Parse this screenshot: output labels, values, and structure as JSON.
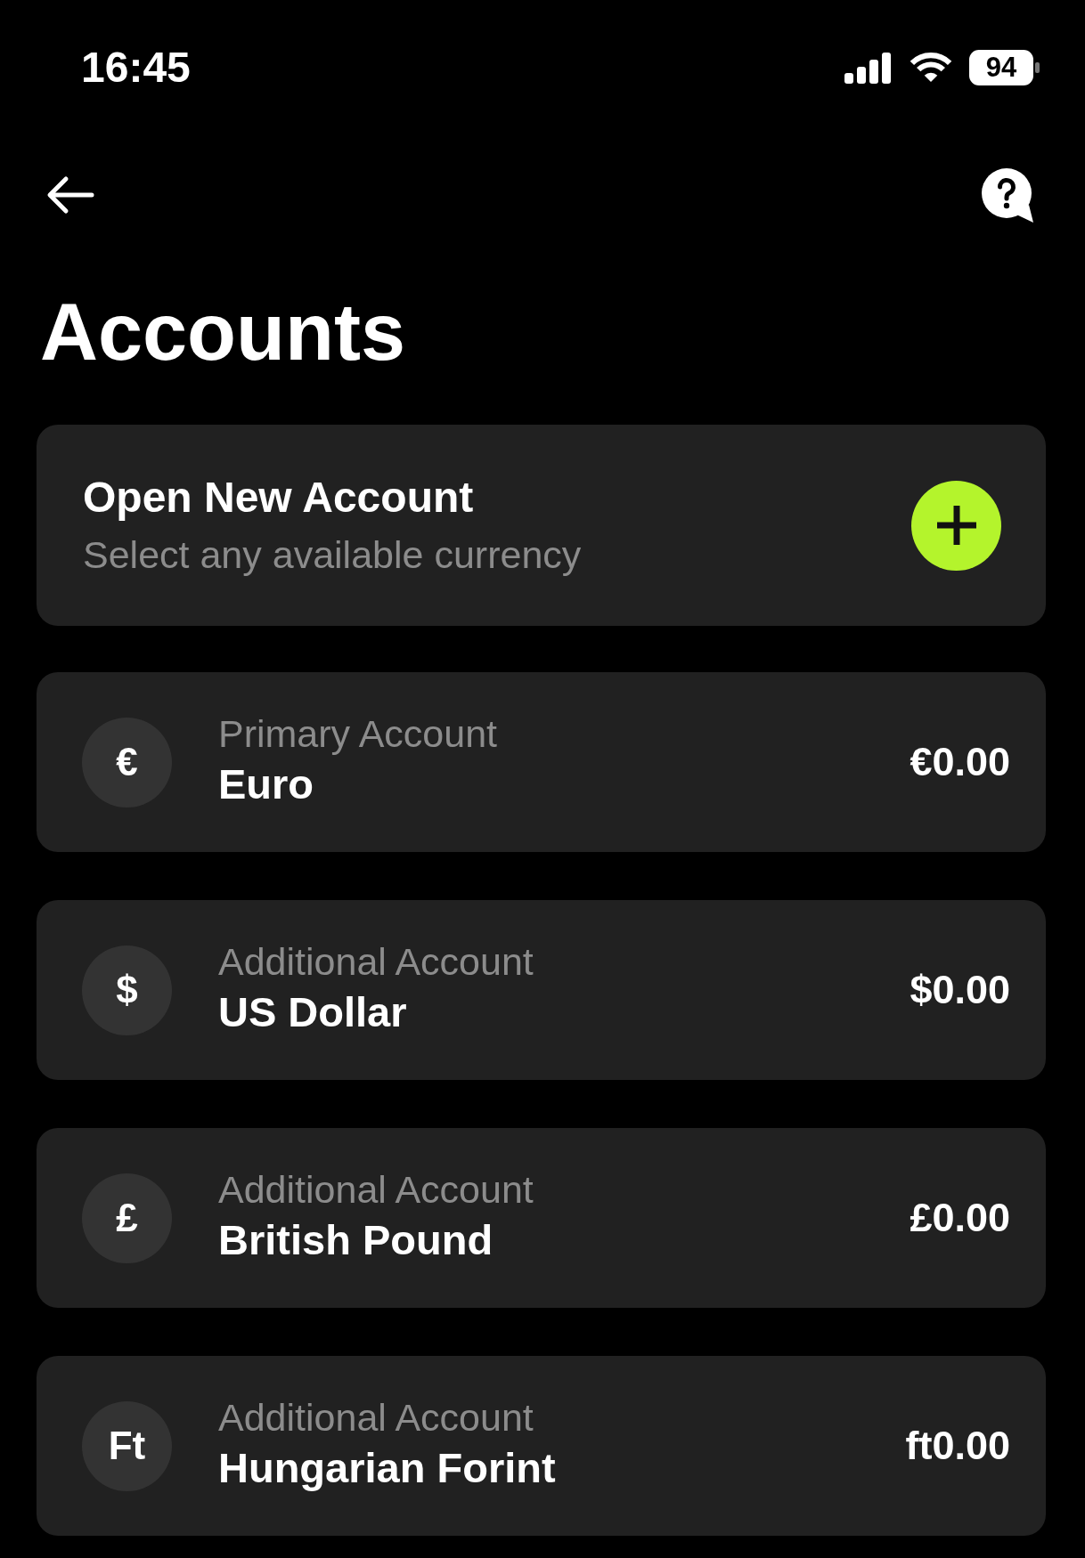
{
  "status_bar": {
    "time": "16:45",
    "battery": "94"
  },
  "header": {
    "title": "Accounts"
  },
  "open_account": {
    "title": "Open New Account",
    "subtitle": "Select any available currency"
  },
  "accounts": [
    {
      "label": "Primary Account",
      "name": "Euro",
      "symbol": "€",
      "balance": "€0.00"
    },
    {
      "label": "Additional Account",
      "name": "US Dollar",
      "symbol": "$",
      "balance": "$0.00"
    },
    {
      "label": "Additional Account",
      "name": "British Pound",
      "symbol": "£",
      "balance": "£0.00"
    },
    {
      "label": "Additional Account",
      "name": "Hungarian Forint",
      "symbol": "Ft",
      "balance": "ft0.00"
    }
  ]
}
